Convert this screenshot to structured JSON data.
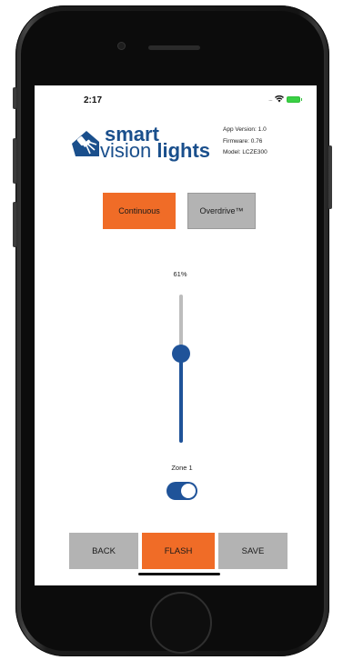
{
  "status_bar": {
    "time": "2:17",
    "signal_dots": "....",
    "wifi_icon": "wifi-icon",
    "battery_icon": "battery-charging-icon"
  },
  "header": {
    "logo_word_1": "smart",
    "logo_word_2a": "vision",
    "logo_word_2b": "lights",
    "app_version": "App Version: 1.0",
    "firmware": "Firmware: 0.76",
    "model": "Model: LCZE300"
  },
  "mode_tabs": {
    "continuous_label": "Continuous",
    "overdrive_label": "Overdrive™",
    "selected": "Continuous"
  },
  "intensity": {
    "percent_label": "61%",
    "value": 0.61
  },
  "zone": {
    "label": "Zone 1",
    "enabled": true
  },
  "actions": {
    "back_label": "BACK",
    "flash_label": "FLASH",
    "save_label": "SAVE"
  },
  "colors": {
    "accent_orange": "#f06c27",
    "brand_blue": "#1a4f8c",
    "control_blue": "#1f5399",
    "inactive_gray": "#b3b3b3"
  }
}
